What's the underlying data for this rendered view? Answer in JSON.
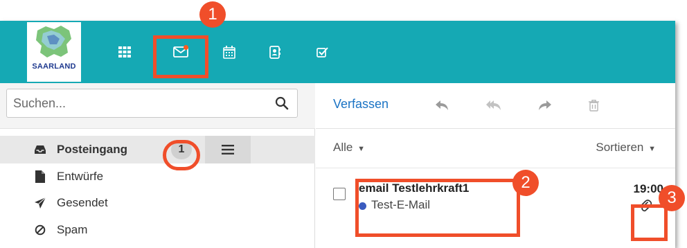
{
  "logo": {
    "text": "SAARLAND"
  },
  "nav": [
    {
      "name": "apps-grid-icon"
    },
    {
      "name": "mail-icon",
      "has_unread": true
    },
    {
      "name": "calendar-icon"
    },
    {
      "name": "contacts-icon"
    },
    {
      "name": "tasks-icon"
    }
  ],
  "search": {
    "placeholder": "Suchen..."
  },
  "folders": [
    {
      "label": "Posteingang",
      "icon": "inbox-icon",
      "count": "1",
      "active": true
    },
    {
      "label": "Entwürfe",
      "icon": "draft-file-icon"
    },
    {
      "label": "Gesendet",
      "icon": "send-icon"
    },
    {
      "label": "Spam",
      "icon": "spam-icon"
    }
  ],
  "toolbar": {
    "compose_label": "Verfassen",
    "icons": [
      "reply-icon",
      "reply-all-icon",
      "forward-icon",
      "trash-icon"
    ]
  },
  "list_header": {
    "filter_label": "Alle",
    "sort_label": "Sortieren"
  },
  "messages": [
    {
      "sender": "email Testlehrkraft1",
      "subject": "Test-E-Mail",
      "time": "19:00",
      "has_attachment": true
    }
  ],
  "annotations": [
    {
      "number": "1"
    },
    {
      "number": "2"
    },
    {
      "number": "3"
    }
  ],
  "colors": {
    "topbar": "#15a9b4",
    "annotation": "#f04e2a",
    "link": "#1a73c4",
    "unread_dot": "#ff5a1f",
    "subject_dot": "#3a5bbf"
  }
}
